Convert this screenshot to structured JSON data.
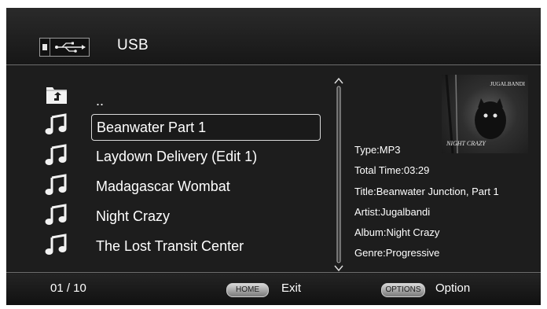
{
  "header": {
    "title": "USB",
    "source_icon": "usb-icon"
  },
  "list": {
    "items": [
      {
        "label": "..",
        "icon": "parent-folder-icon",
        "selected": false
      },
      {
        "label": "Beanwater Part 1",
        "icon": "music-note-icon",
        "selected": true
      },
      {
        "label": "Laydown Delivery (Edit 1)",
        "icon": "music-note-icon",
        "selected": false
      },
      {
        "label": "Madagascar Wombat",
        "icon": "music-note-icon",
        "selected": false
      },
      {
        "label": "Night Crazy",
        "icon": "music-note-icon",
        "selected": false
      },
      {
        "label": "The Lost Transit Center",
        "icon": "music-note-icon",
        "selected": false
      }
    ]
  },
  "album_art": {
    "top_text": "JUGALBANDI",
    "bottom_text": "NIGHT CRAZY"
  },
  "info": {
    "type": "Type:MP3",
    "total_time": "Total Time:03:29",
    "title": "Title:Beanwater Junction, Part 1",
    "artist": "Artist:Jugalbandi",
    "album": "Album:Night Crazy",
    "genre": "Genre:Progressive"
  },
  "footer": {
    "page_counter": "01 / 10",
    "home_button": "HOME",
    "home_action": "Exit",
    "options_button": "OPTIONS",
    "options_action": "Option"
  },
  "colors": {
    "background": "#1d1d1d",
    "text": "#ffffff",
    "separator": "#6d6d6d"
  }
}
